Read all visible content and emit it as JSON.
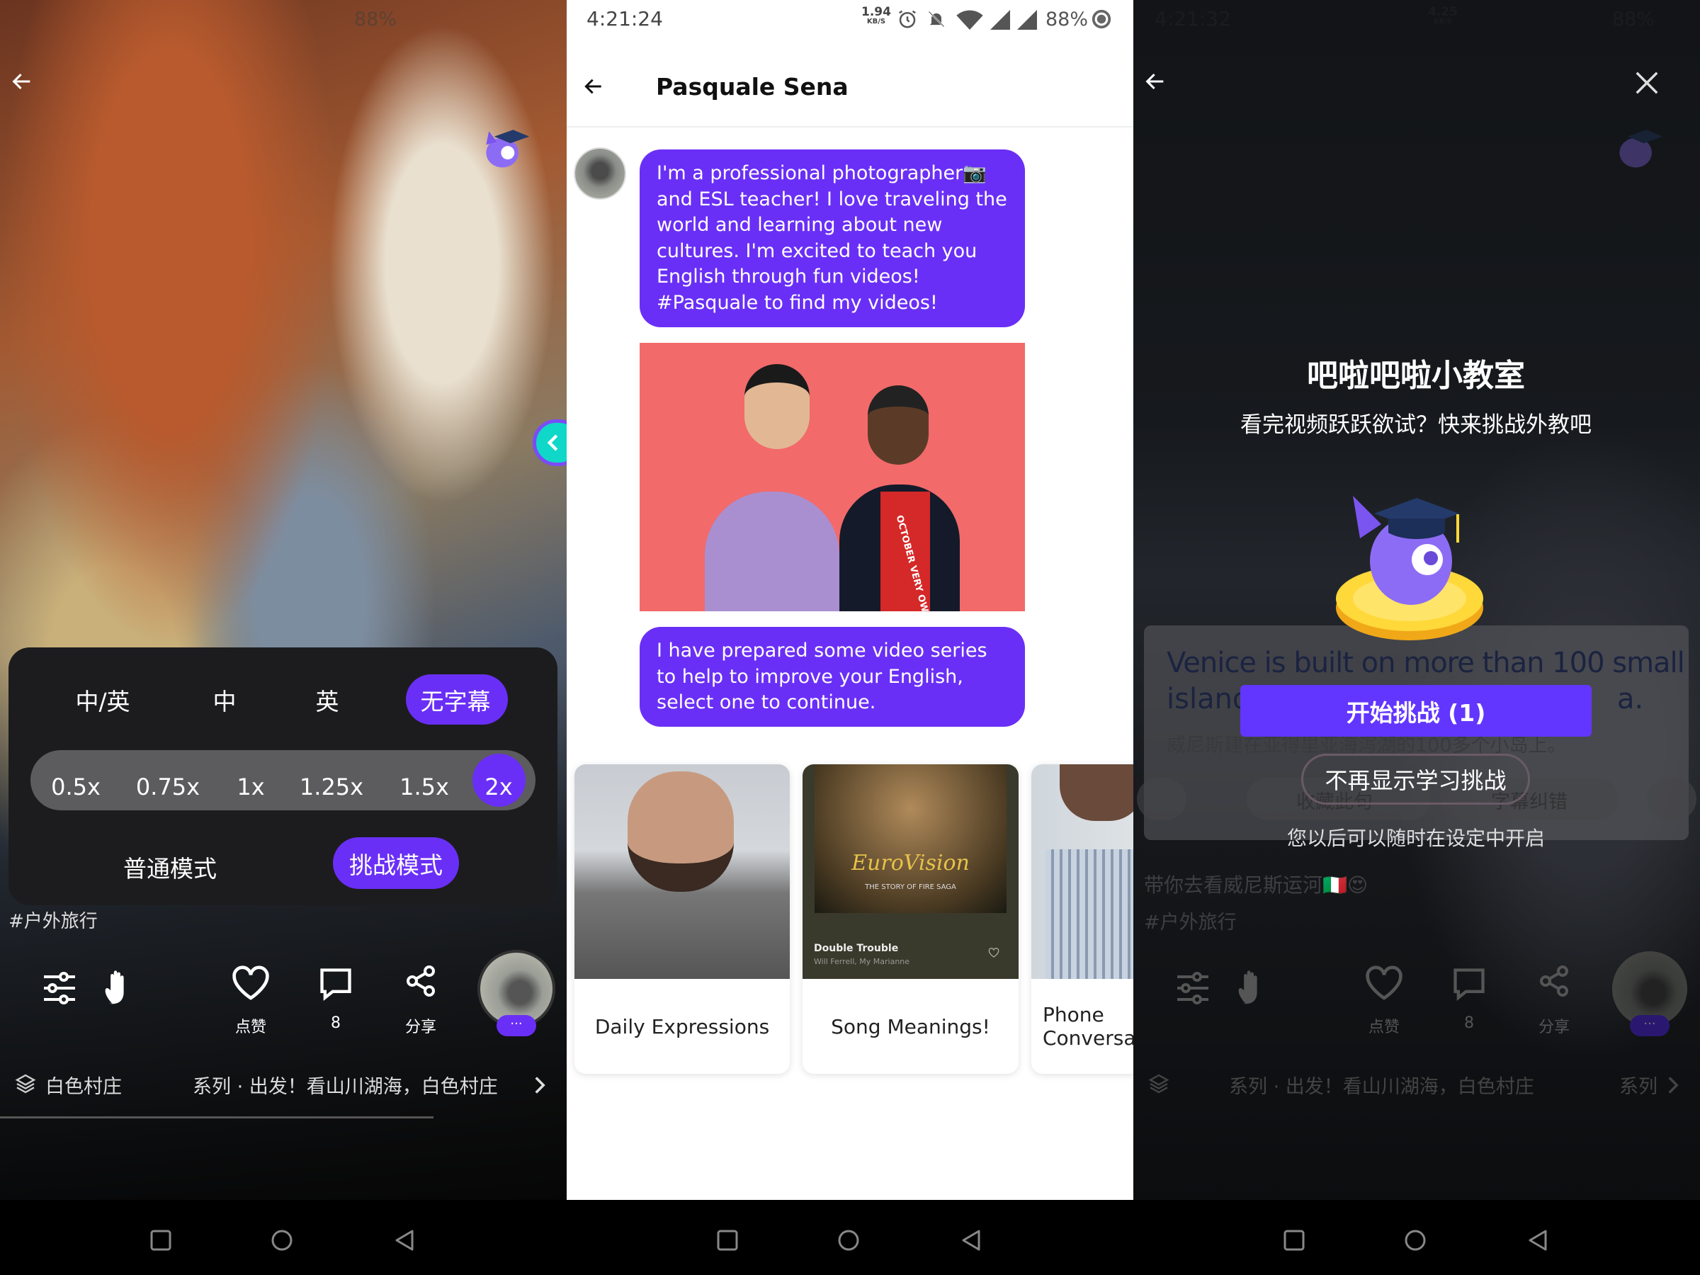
{
  "colors": {
    "accent": "#6a2ff6",
    "button": "#6236ff",
    "coral": "#f26a6a"
  },
  "left": {
    "status": {
      "battery": "88%"
    },
    "subtitle_options": [
      "中/英",
      "中",
      "英",
      "无字幕"
    ],
    "subtitle_selected": "无字幕",
    "speeds": [
      "0.5x",
      "0.75x",
      "1x",
      "1.25x",
      "1.5x",
      "2x"
    ],
    "speed_selected": "2x",
    "modes": {
      "normal": "普通模式",
      "challenge": "挑战模式",
      "selected": "挑战模式"
    },
    "hashtag": "#户外旅行",
    "actions": {
      "like": "点赞",
      "comments": "8",
      "share": "分享",
      "more": "···"
    },
    "series_partial": "白色村庄",
    "series": "系列 · 出发！看山川湖海，白色村庄"
  },
  "middle": {
    "status": {
      "time": "4:21:24",
      "speed": "1.94",
      "speed_unit": "KB/S",
      "battery": "88%"
    },
    "title": "Pasquale Sena",
    "messages": [
      "I'm a professional photographer📷 and ESL teacher! I love traveling the world and learning about new cultures. I'm excited to teach you English through fun videos! #Pasquale to find my videos!",
      "I have prepared some video series to help to improve your English, select one to continue."
    ],
    "image_text": "OCTOBER VERY OWN",
    "series_cards": [
      {
        "title": "Daily Expressions"
      },
      {
        "title": "Song Meanings!",
        "poster_title": "EuroVision",
        "poster_sub": "THE STORY OF FIRE SAGA",
        "song": "Double Trouble",
        "artist": "Will Ferrell, My Marianne"
      },
      {
        "title": "Phone Conversa"
      }
    ]
  },
  "right": {
    "status": {
      "time": "4:21:32",
      "speed": "4.25",
      "speed_unit": "KB/S",
      "battery": "88%"
    },
    "dialog": {
      "title": "吧啦吧啦小教室",
      "subtitle": "看完视频跃跃欲试？快来挑战外教吧",
      "start_button": "开始挑战 (1)",
      "dismiss_button": "不再显示学习挑战",
      "note": "您以后可以随时在设定中开启"
    },
    "sentence_en_1": "Venice is built on more than 100 small",
    "sentence_en_2a": "islands",
    "sentence_en_2b": "a.",
    "sentence_cn": "威尼斯建在亚得里亚海泻湖的100多个小岛上。",
    "bookmark_label": "收藏此句",
    "correct_label": "字幕纠错",
    "caption": "带你去看威尼斯运河🇮🇹😍",
    "hashtag": "#户外旅行",
    "actions": {
      "like": "点赞",
      "comments": "8",
      "share": "分享",
      "more": "···"
    },
    "series": "系列 · 出发！看山川湖海，白色村庄",
    "series_next_partial": "系列"
  }
}
